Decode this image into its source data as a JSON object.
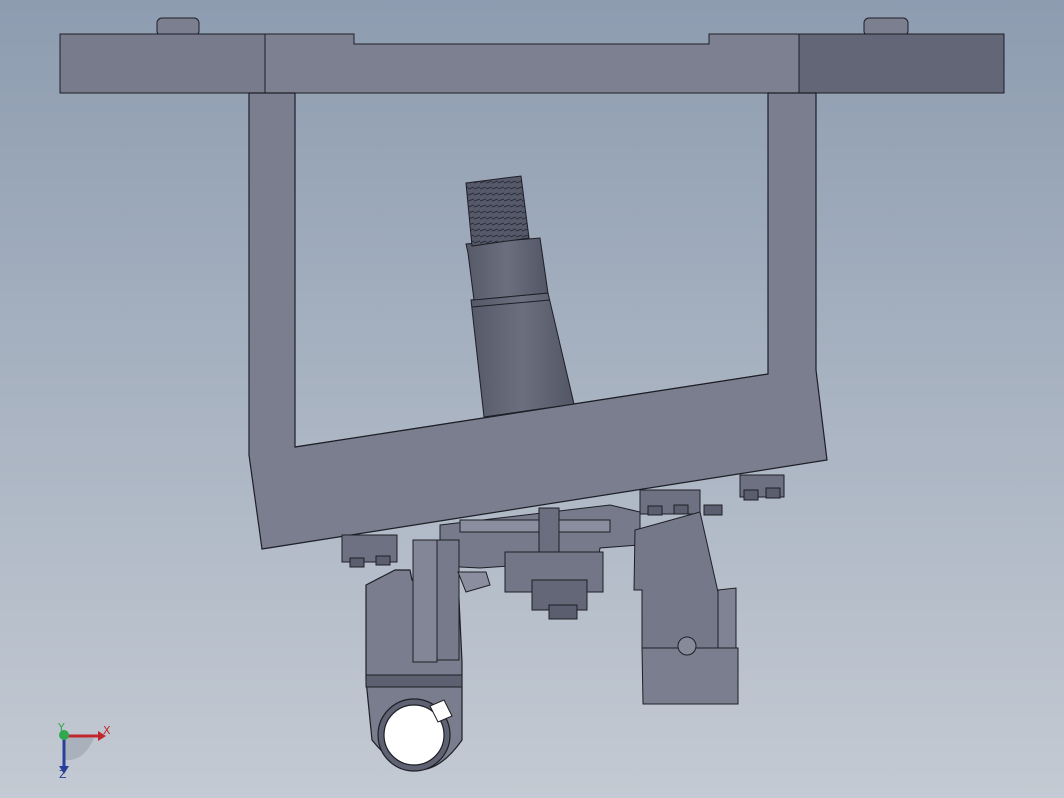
{
  "viewport": {
    "background_top": "#8d9cb0",
    "background_bottom": "#c4cad3",
    "part_color": "#7b7f90",
    "part_dark": "#5f6373",
    "edge_color": "#1e1e26"
  },
  "triad": {
    "x_label": "X",
    "y_label": "Y",
    "z_label": "Z",
    "x_color": "#c0272d",
    "y_color": "#2fa84f",
    "z_color": "#2a3f9a"
  }
}
